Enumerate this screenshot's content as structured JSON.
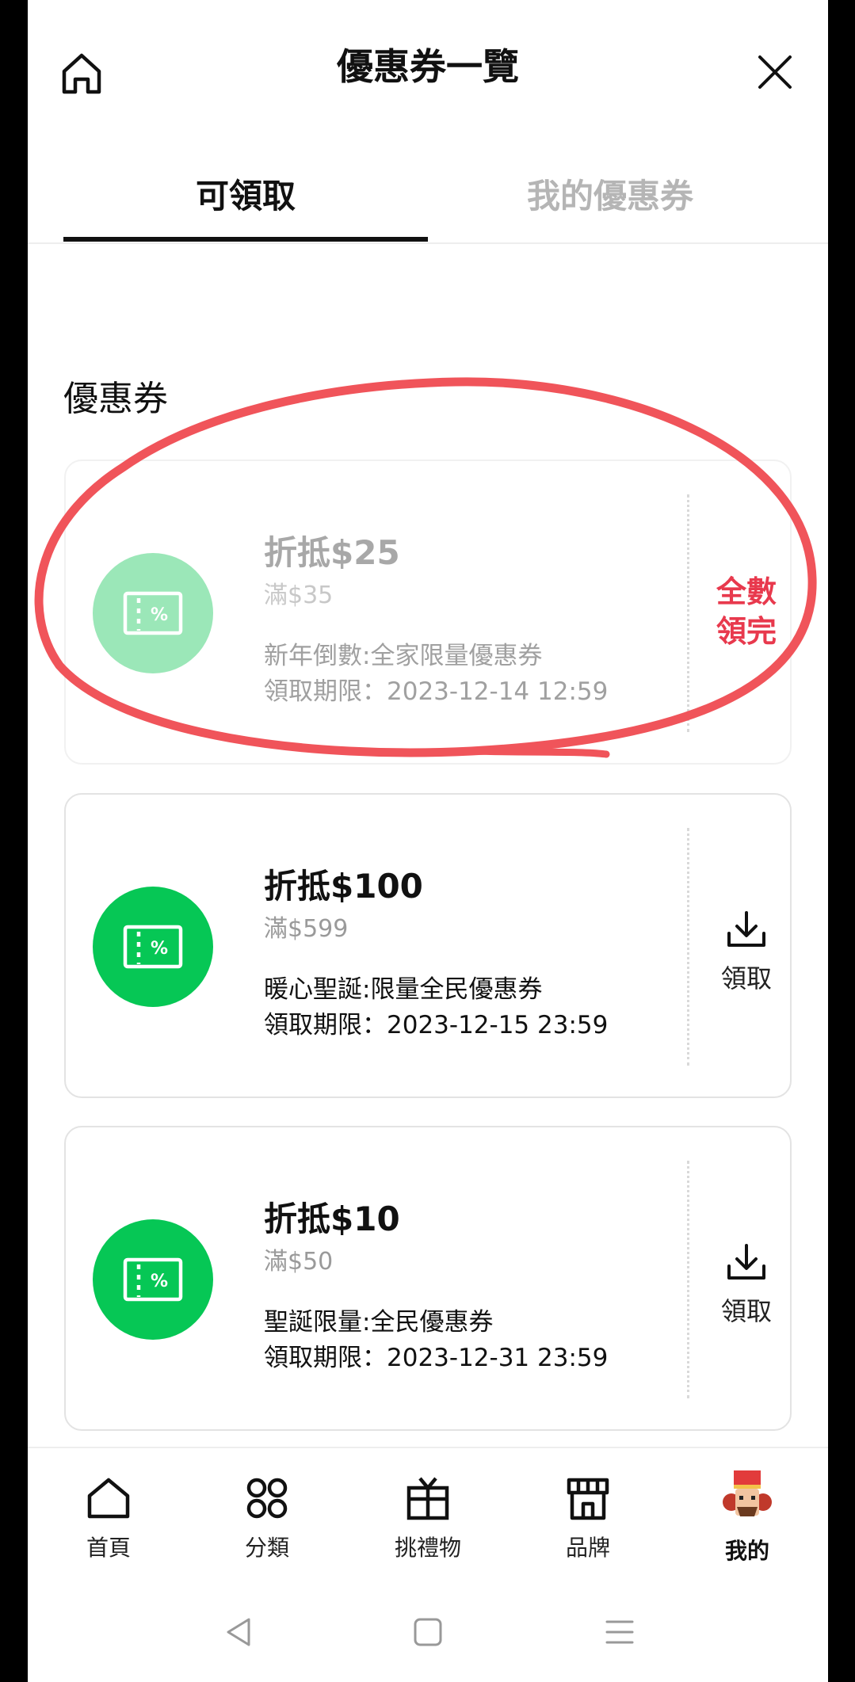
{
  "header": {
    "title": "優惠券一覽"
  },
  "tabs": [
    {
      "label": "可領取",
      "active": true
    },
    {
      "label": "我的優惠券",
      "active": false
    }
  ],
  "section": {
    "title": "優惠券"
  },
  "coupons": [
    {
      "amount": "折抵$25",
      "minimum": "滿$35",
      "description": "新年倒數:全家限量優惠券",
      "deadline": "領取期限：2023-12-14 12:59",
      "status": "全數領完",
      "status_line1": "全數",
      "status_line2": "領完",
      "circled": true
    },
    {
      "amount": "折抵$100",
      "minimum": "滿$599",
      "description": "暖心聖誕:限量全民優惠券",
      "deadline": "領取期限：2023-12-15 23:59",
      "action_label": "領取"
    },
    {
      "amount": "折抵$10",
      "minimum": "滿$50",
      "description": "聖誕限量:全民優惠券",
      "deadline": "領取期限：2023-12-31 23:59",
      "action_label": "領取"
    }
  ],
  "bottom_nav": [
    {
      "label": "首頁",
      "icon": "home-icon"
    },
    {
      "label": "分類",
      "icon": "grid-icon"
    },
    {
      "label": "挑禮物",
      "icon": "gift-icon"
    },
    {
      "label": "品牌",
      "icon": "store-icon"
    },
    {
      "label": "我的",
      "icon": "avatar-icon",
      "active": true
    }
  ],
  "colors": {
    "brand_green": "#06c755",
    "sold_out_red": "#e8394d",
    "annotation_red": "#f0545a"
  }
}
